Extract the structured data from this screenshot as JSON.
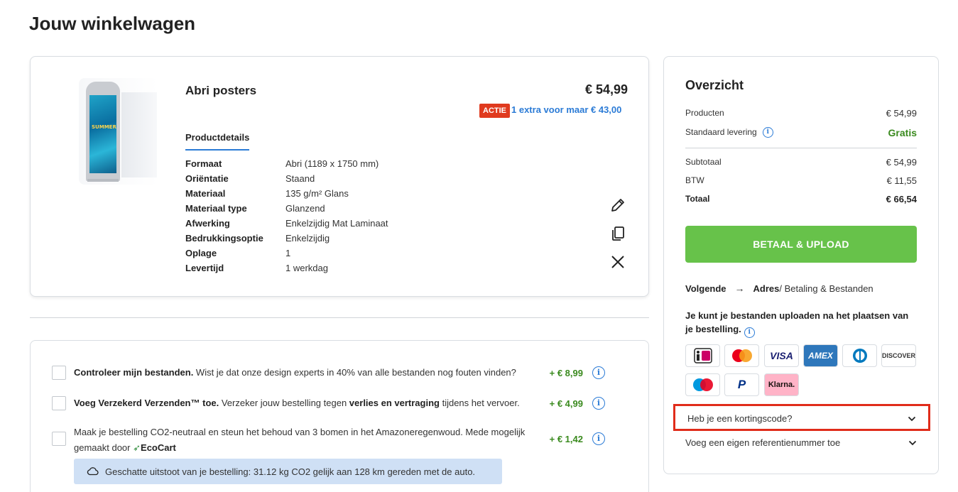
{
  "page": {
    "title": "Jouw winkelwagen"
  },
  "product": {
    "name": "Abri posters",
    "price": "€ 54,99",
    "promo_badge": "ACTIE",
    "promo_text": "1 extra voor maar € 43,00",
    "poster_text": "SUMMER",
    "details_tab": "Productdetails",
    "specs": [
      {
        "label": "Formaat",
        "value": "Abri (1189 x 1750 mm)"
      },
      {
        "label": "Oriëntatie",
        "value": "Staand"
      },
      {
        "label": "Materiaal",
        "value": "135 g/m² Glans"
      },
      {
        "label": "Materiaal type",
        "value": "Glanzend"
      },
      {
        "label": "Afwerking",
        "value": "Enkelzijdig Mat Laminaat"
      },
      {
        "label": "Bedrukkingsoptie",
        "value": "Enkelzijdig"
      },
      {
        "label": "Oplage",
        "value": "1"
      },
      {
        "label": "Levertijd",
        "value": "1 werkdag"
      }
    ],
    "actions": [
      "pencil-icon",
      "copy-icon",
      "close-icon"
    ]
  },
  "extras": [
    {
      "bold": "Controleer mijn bestanden.",
      "text": " Wist je dat onze design experts in 40% van alle bestanden nog fouten vinden?",
      "price": "+ € 8,99"
    },
    {
      "bold": "Voeg Verzekerd Verzenden™ toe.",
      "text_before": " Verzeker jouw bestelling tegen ",
      "bold2": "verlies en vertraging",
      "text_after": " tijdens het vervoer.",
      "price": "+ € 4,99"
    },
    {
      "text": "Maak je bestelling CO2-neutraal en steun het behoud van 3 bomen in het Amazoneregenwoud. Mede mogelijk gemaakt door",
      "brand": "EcoCart",
      "price": "+ € 1,42"
    }
  ],
  "emission": {
    "text": "Geschatte uitstoot van je bestelling: 31.12 kg CO2 gelijk aan 128 km gereden met de auto."
  },
  "overview": {
    "title": "Overzicht",
    "rows": [
      {
        "label": "Producten",
        "value": "€ 54,99"
      },
      {
        "label": "Standaard levering",
        "value": "Gratis"
      },
      {
        "label": "Subtotaal",
        "value": "€ 54,99"
      },
      {
        "label": "BTW",
        "value": "€ 11,55"
      },
      {
        "label": "Totaal",
        "value": "€ 66,54"
      }
    ],
    "pay_button": "BETAAL & UPLOAD",
    "next": {
      "label": "Volgende",
      "current": "Adres",
      "rest": " / Betaling & Bestanden"
    },
    "upload_note": "Je kunt je bestanden uploaden na het plaatsen van je bestelling.",
    "payment_methods": [
      {
        "name": "iDEAL",
        "icon": "ideal-icon"
      },
      {
        "name": "Mastercard",
        "icon": "mastercard-icon"
      },
      {
        "name": "VISA",
        "icon": "visa-icon"
      },
      {
        "name": "AMEX",
        "icon": "amex-icon"
      },
      {
        "name": "Diners",
        "icon": "diners-icon"
      },
      {
        "name": "DISCOVER",
        "icon": "discover-icon"
      },
      {
        "name": "Maestro",
        "icon": "maestro-icon"
      },
      {
        "name": "PayPal",
        "icon": "paypal-icon"
      },
      {
        "name": "Klarna.",
        "icon": "klarna-icon"
      }
    ],
    "discount_label": "Heb je een kortingscode?",
    "reference_label": "Voeg een eigen referentienummer toe"
  },
  "colors": {
    "accent_blue": "#2b7bd6",
    "pay_green": "#67c24a",
    "price_green": "#3a8a1e",
    "badge_red": "#e03a1e",
    "highlight_red": "#e02c1a"
  }
}
